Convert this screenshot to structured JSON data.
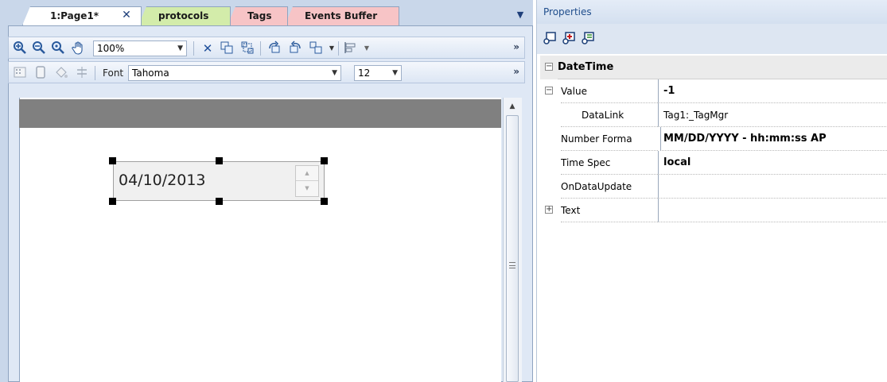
{
  "editor": {
    "tabs": [
      {
        "label": "1:Page1*",
        "color": "#ffffff",
        "active": true
      },
      {
        "label": "protocols",
        "color": "#d3ecaa"
      },
      {
        "label": "Tags",
        "color": "#f7c4c6"
      },
      {
        "label": "Events Buffer",
        "color": "#f7c4c6"
      }
    ],
    "tab_close_glyph": "✕",
    "tabs_dropdown_glyph": "▼",
    "toolbar1": {
      "icons": [
        "zoom-in-icon",
        "zoom-out-icon",
        "zoom-fit-icon",
        "pan-hand-icon"
      ],
      "zoom_value": "100%",
      "more_glyph": "»"
    },
    "toolbar2": {
      "font_label": "Font",
      "font_value": "Tahoma",
      "font_size_value": "12",
      "more_glyph": "»"
    },
    "canvas": {
      "header_color": "#808080",
      "datetime_control": {
        "value": "04/10/2013"
      }
    }
  },
  "properties": {
    "title": "Properties",
    "toolbar_icons": [
      "categorized-view-icon",
      "add-property-icon",
      "alphabetical-view-icon"
    ],
    "category": {
      "label": "DateTime",
      "expander": "−"
    },
    "rows": [
      {
        "name": "Value",
        "value": "-1",
        "value_bold": true,
        "expander": "−"
      },
      {
        "name": "DataLink",
        "value": "Tag1:_TagMgr",
        "value_bold": false
      },
      {
        "name": "Number Forma",
        "value": "MM/DD/YYYY - hh:mm:ss AP",
        "value_bold": true
      },
      {
        "name": "Time Spec",
        "value": "local",
        "value_bold": true
      },
      {
        "name": "OnDataUpdate",
        "value": "",
        "value_bold": false
      },
      {
        "name": "Text",
        "value": "",
        "value_bold": false,
        "expander": "+"
      }
    ]
  }
}
